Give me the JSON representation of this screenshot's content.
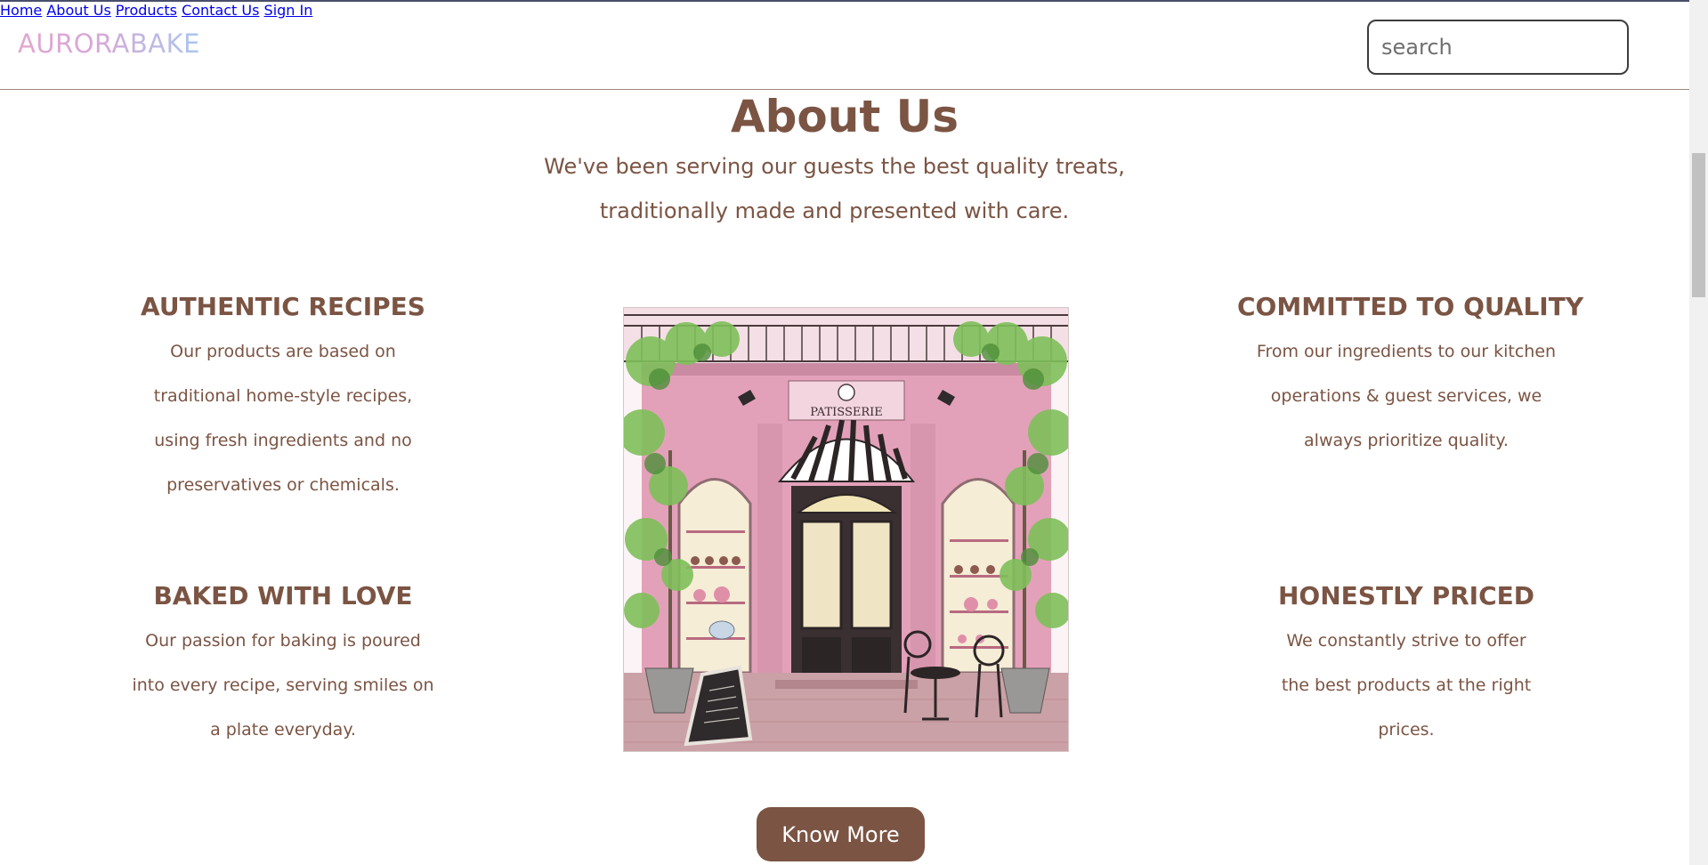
{
  "header": {
    "logo": "AURORABAKE",
    "nav": [
      {
        "label": "Home"
      },
      {
        "label": "About Us"
      },
      {
        "label": "Products"
      },
      {
        "label": "Contact Us"
      },
      {
        "label": "Sign In"
      }
    ],
    "search_placeholder": "search"
  },
  "about": {
    "title": "About Us",
    "subtitle_line1": "We've been serving our guests the best quality treats,",
    "subtitle_line2": "traditionally made and presented with care.",
    "features": [
      {
        "title": "AUTHENTIC RECIPES",
        "text": "Our products are based on traditional home-style recipes, using fresh ingredients and no preservatives or chemicals."
      },
      {
        "title": "BAKED WITH LOVE",
        "text": "Our passion for baking is poured into every recipe, serving smiles on a plate everyday."
      },
      {
        "title": "COMMITTED TO QUALITY",
        "text": "From our ingredients to our kitchen operations & guest services, we always prioritize quality."
      },
      {
        "title": "HONESTLY PRICED",
        "text": "We constantly strive to offer the best products at the right prices."
      }
    ],
    "image_sign": "PATISSERIE",
    "button_label": "Know More"
  },
  "colors": {
    "brand_brown": "#7b5443",
    "logo_pink": "#e3a6cf",
    "logo_blue": "#a9c6ee",
    "shop_pink": "#e9a9c0"
  }
}
